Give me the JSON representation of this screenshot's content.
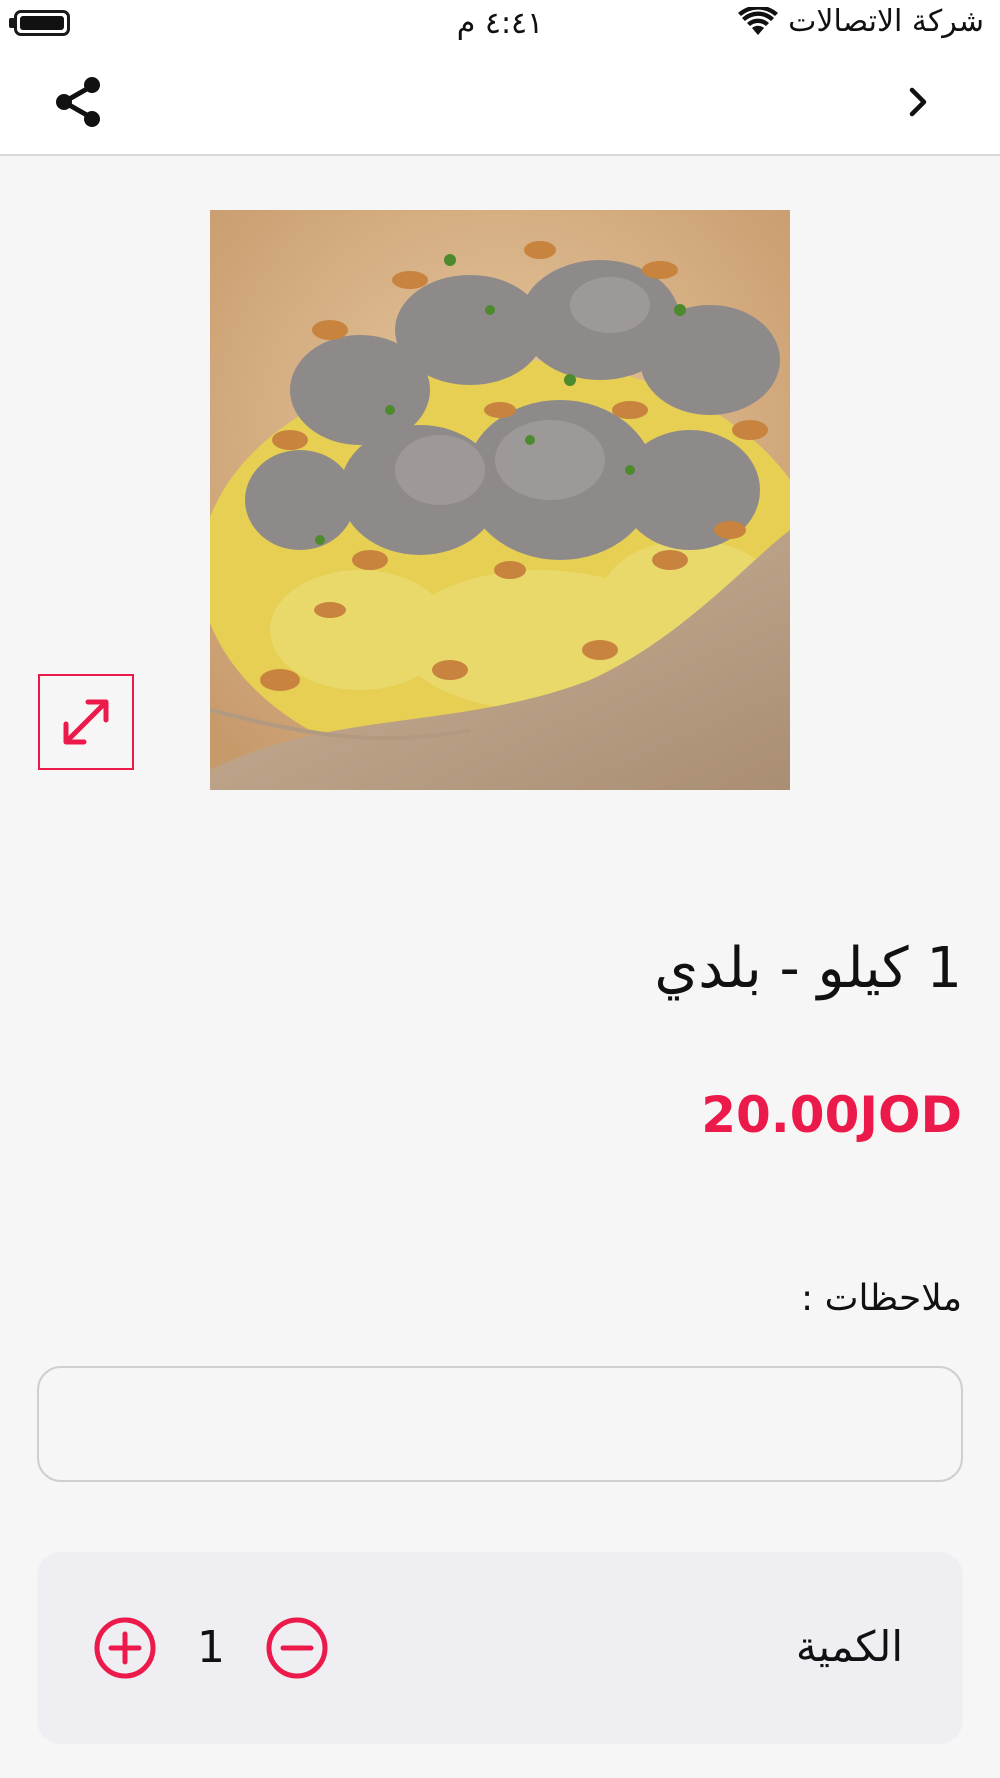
{
  "status_bar": {
    "time": "٤:٤١ م",
    "carrier": "شركة الاتصالات"
  },
  "product": {
    "title": "1 كيلو - بلدي",
    "price": "20.00JOD"
  },
  "notes": {
    "label": "ملاحظات :",
    "value": ""
  },
  "quantity": {
    "label": "الكمية",
    "value": "1"
  },
  "icons": {
    "battery": "battery-icon",
    "wifi": "wifi-icon",
    "share": "share-icon",
    "back": "chevron-right-icon",
    "expand": "expand-icon",
    "plus": "plus-circle-icon",
    "minus": "minus-circle-icon"
  },
  "colors": {
    "accent": "#ec1a4b",
    "background": "#f7f6f6",
    "panel": "#efeef2"
  }
}
